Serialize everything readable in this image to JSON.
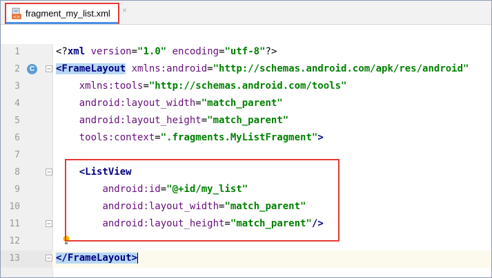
{
  "tab": {
    "filename": "fragment_my_list.xml",
    "close_glyph": "×",
    "icon": "xml-file-icon"
  },
  "gutter": {
    "badge_letter": "C",
    "icons": [
      "fold-icon",
      "class-badge-icon",
      "lightbulb-icon"
    ]
  },
  "lines": [
    {
      "num": "1",
      "segments": [
        [
          "plain",
          "<?"
        ],
        [
          "tag",
          "xml "
        ],
        [
          "attr",
          "version"
        ],
        [
          "plain",
          "="
        ],
        [
          "val",
          "\"1.0\""
        ],
        [
          "plain",
          " "
        ],
        [
          "attr",
          "encoding"
        ],
        [
          "plain",
          "="
        ],
        [
          "val",
          "\"utf-8\""
        ],
        [
          "plain",
          "?>"
        ]
      ]
    },
    {
      "num": "2",
      "segments": [
        [
          "hltag",
          "<FrameLayout"
        ],
        [
          "plain",
          " "
        ],
        [
          "attr",
          "xmlns:android"
        ],
        [
          "plain",
          "="
        ],
        [
          "val",
          "\"http://schemas.android.com/apk/res/android\""
        ]
      ]
    },
    {
      "num": "3",
      "segments": [
        [
          "plain",
          "    "
        ],
        [
          "attr",
          "xmlns:tools"
        ],
        [
          "plain",
          "="
        ],
        [
          "val",
          "\"http://schemas.android.com/tools\""
        ]
      ]
    },
    {
      "num": "4",
      "segments": [
        [
          "plain",
          "    "
        ],
        [
          "attr",
          "android:layout_width"
        ],
        [
          "plain",
          "="
        ],
        [
          "val",
          "\"match_parent\""
        ]
      ]
    },
    {
      "num": "5",
      "segments": [
        [
          "plain",
          "    "
        ],
        [
          "attr",
          "android:layout_height"
        ],
        [
          "plain",
          "="
        ],
        [
          "val",
          "\"match_parent\""
        ]
      ]
    },
    {
      "num": "6",
      "segments": [
        [
          "plain",
          "    "
        ],
        [
          "attr",
          "tools:context"
        ],
        [
          "plain",
          "="
        ],
        [
          "val",
          "\".fragments.MyListFragment\""
        ],
        [
          "tag",
          ">"
        ]
      ]
    },
    {
      "num": "7",
      "segments": []
    },
    {
      "num": "8",
      "segments": [
        [
          "plain",
          "    "
        ],
        [
          "tag",
          "<ListView"
        ]
      ]
    },
    {
      "num": "9",
      "segments": [
        [
          "plain",
          "        "
        ],
        [
          "attr",
          "android:id"
        ],
        [
          "plain",
          "="
        ],
        [
          "val",
          "\"@+id/my_list\""
        ]
      ]
    },
    {
      "num": "10",
      "segments": [
        [
          "plain",
          "        "
        ],
        [
          "attr",
          "android:layout_width"
        ],
        [
          "plain",
          "="
        ],
        [
          "val",
          "\"match_parent\""
        ]
      ]
    },
    {
      "num": "11",
      "segments": [
        [
          "plain",
          "        "
        ],
        [
          "attr",
          "android:layout_height"
        ],
        [
          "plain",
          "="
        ],
        [
          "val",
          "\"match_parent\""
        ],
        [
          "tag",
          "/>"
        ]
      ]
    },
    {
      "num": "12",
      "segments": []
    },
    {
      "num": "13",
      "segments": [
        [
          "hltag",
          "</FrameLayout>"
        ]
      ]
    }
  ],
  "colors": {
    "tag": "#000080",
    "attr": "#660e7a",
    "value": "#008000",
    "highlight": "#b8d7f5",
    "annotation_box": "#e53935"
  }
}
